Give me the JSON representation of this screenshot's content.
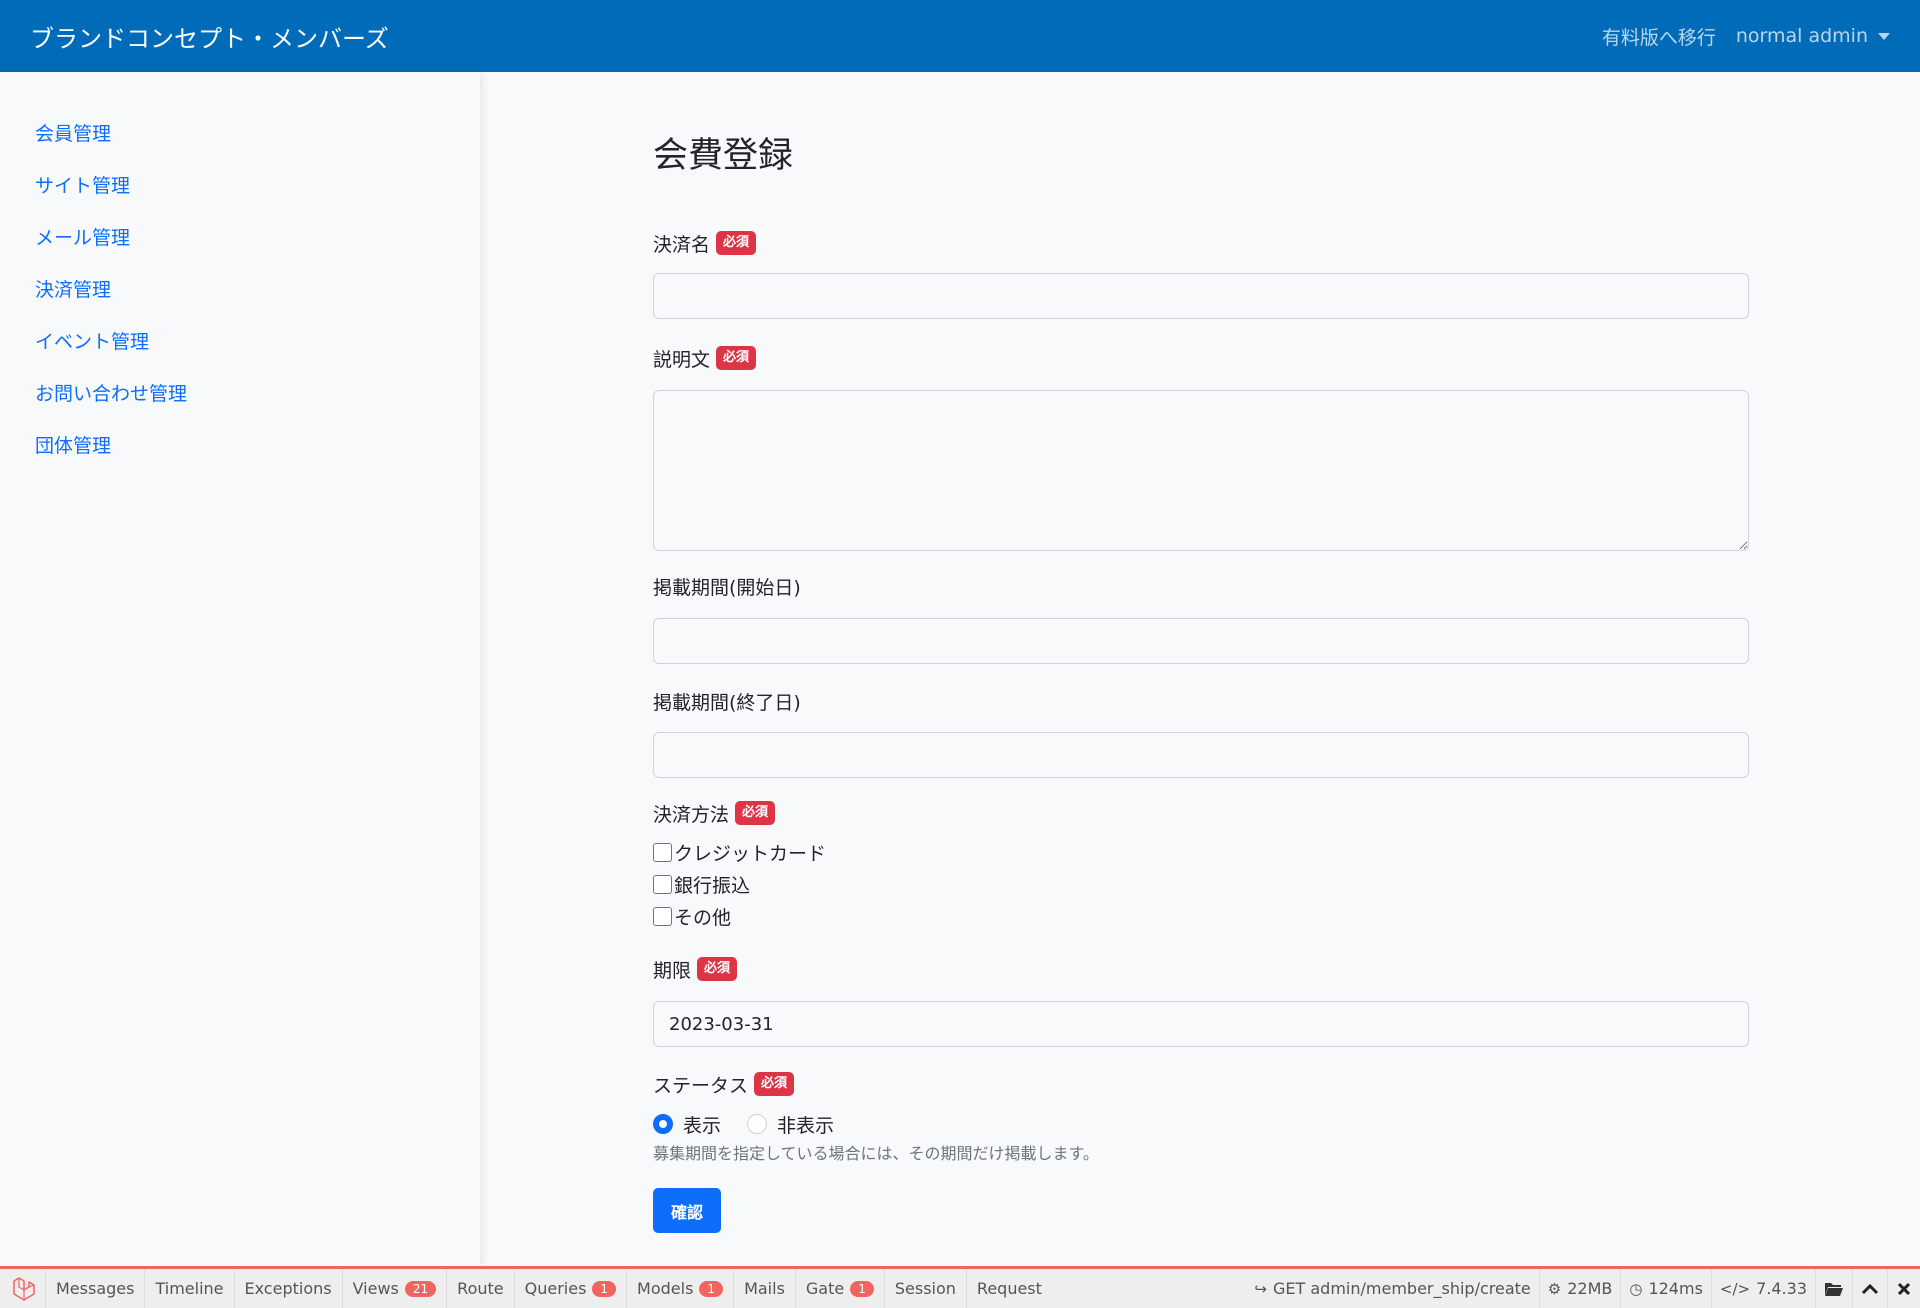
{
  "navbar": {
    "brand": "ブランドコンセプト・メンバーズ",
    "upgrade_link": "有料版へ移行",
    "user_name": "normal admin",
    "bg_color": "#006bb9"
  },
  "sidebar": {
    "items": [
      {
        "label": "会員管理"
      },
      {
        "label": "サイト管理"
      },
      {
        "label": "メール管理"
      },
      {
        "label": "決済管理"
      },
      {
        "label": "イベント管理"
      },
      {
        "label": "お問い合わせ管理"
      },
      {
        "label": "団体管理"
      }
    ]
  },
  "form": {
    "title": "会費登録",
    "required_badge": "必須",
    "payment_name": {
      "label": "決済名",
      "value": ""
    },
    "description": {
      "label": "説明文",
      "value": ""
    },
    "start_date": {
      "label": "掲載期間(開始日)",
      "value": ""
    },
    "end_date": {
      "label": "掲載期間(終了日)",
      "value": ""
    },
    "payment_method": {
      "label": "決済方法",
      "options": [
        {
          "label": "クレジットカード",
          "checked": false
        },
        {
          "label": "銀行振込",
          "checked": false
        },
        {
          "label": "その他",
          "checked": false
        }
      ]
    },
    "deadline": {
      "label": "期限",
      "value": "2023-03-31"
    },
    "status": {
      "label": "ステータス",
      "options": [
        {
          "label": "表示",
          "checked": true
        },
        {
          "label": "非表示",
          "checked": false
        }
      ],
      "help": "募集期間を指定している場合には、その期間だけ掲載します。"
    },
    "submit_label": "確認"
  },
  "debugbar": {
    "tabs": [
      {
        "label": "Messages"
      },
      {
        "label": "Timeline"
      },
      {
        "label": "Exceptions"
      },
      {
        "label": "Views",
        "badge": "21"
      },
      {
        "label": "Route"
      },
      {
        "label": "Queries",
        "badge": "1"
      },
      {
        "label": "Models",
        "badge": "1"
      },
      {
        "label": "Mails"
      },
      {
        "label": "Gate",
        "badge": "1"
      },
      {
        "label": "Session"
      },
      {
        "label": "Request"
      }
    ],
    "route": "GET admin/member_ship/create",
    "memory": "22MB",
    "time": "124ms",
    "php_version": "7.4.33",
    "accent_color": "#f4645f"
  }
}
